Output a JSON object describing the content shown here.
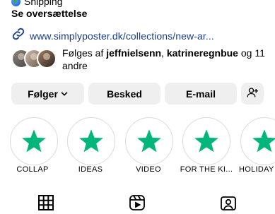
{
  "shipping": {
    "label": "Shipping",
    "icon": "globe-icon"
  },
  "translate": {
    "label": "Se oversættelse"
  },
  "link": {
    "url": "www.simplyposter.dk/collections/new-ar...",
    "icon": "link-icon",
    "color": "#1a3e8a"
  },
  "followers": {
    "prefix": "Følges af ",
    "user1": "jeffnielsenn",
    "separator": ", ",
    "user2": "katrineregnbue",
    "suffix": " og 11 andre",
    "avatars": [
      "avatar-1",
      "avatar-2",
      "avatar-3"
    ]
  },
  "actions": {
    "follow": "Følger",
    "message": "Besked",
    "email": "E-mail",
    "add_person_icon": "add-person-icon"
  },
  "highlights": [
    {
      "label": "COLLAP",
      "icon": "trustpilot-star-icon"
    },
    {
      "label": "IDEAS",
      "icon": "trustpilot-star-icon"
    },
    {
      "label": "VIDEO",
      "icon": "trustpilot-star-icon"
    },
    {
      "label": "FOR THE KI...",
      "icon": "trustpilot-star-icon"
    },
    {
      "label": "HOLIDAY",
      "icon": "trustpilot-star-icon"
    }
  ],
  "tabs": [
    "grid-icon",
    "reels-icon",
    "tagged-icon"
  ],
  "colors": {
    "star": "#00b67a",
    "button_bg": "#efefef",
    "link": "#1a3e8a"
  }
}
